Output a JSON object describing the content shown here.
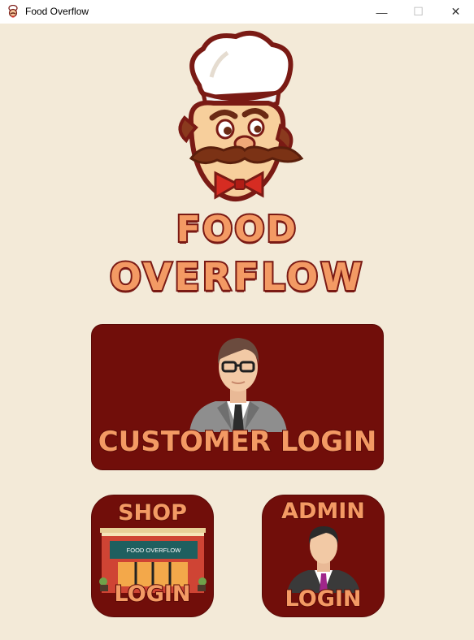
{
  "window": {
    "title": "Food Overflow",
    "minimize_glyph": "—",
    "maximize_glyph": "☐",
    "close_glyph": "✕"
  },
  "brand": {
    "line1": "FOOD",
    "line2": "OVERFLOW"
  },
  "tiles": {
    "customer": {
      "label": "CUSTOMER LOGIN"
    },
    "shop": {
      "top_label": "SHOP",
      "bottom_label": "LOGIN",
      "sign_text": "FOOD OVERFLOW"
    },
    "admin": {
      "top_label": "ADMIN",
      "bottom_label": "LOGIN"
    }
  },
  "colors": {
    "background": "#f3ead8",
    "tile": "#710e0a",
    "accent_text": "#f39a64",
    "outline": "#7a1a14"
  },
  "icons": [
    "chef-mascot-icon",
    "businessman-icon",
    "storefront-icon",
    "admin-person-icon"
  ]
}
